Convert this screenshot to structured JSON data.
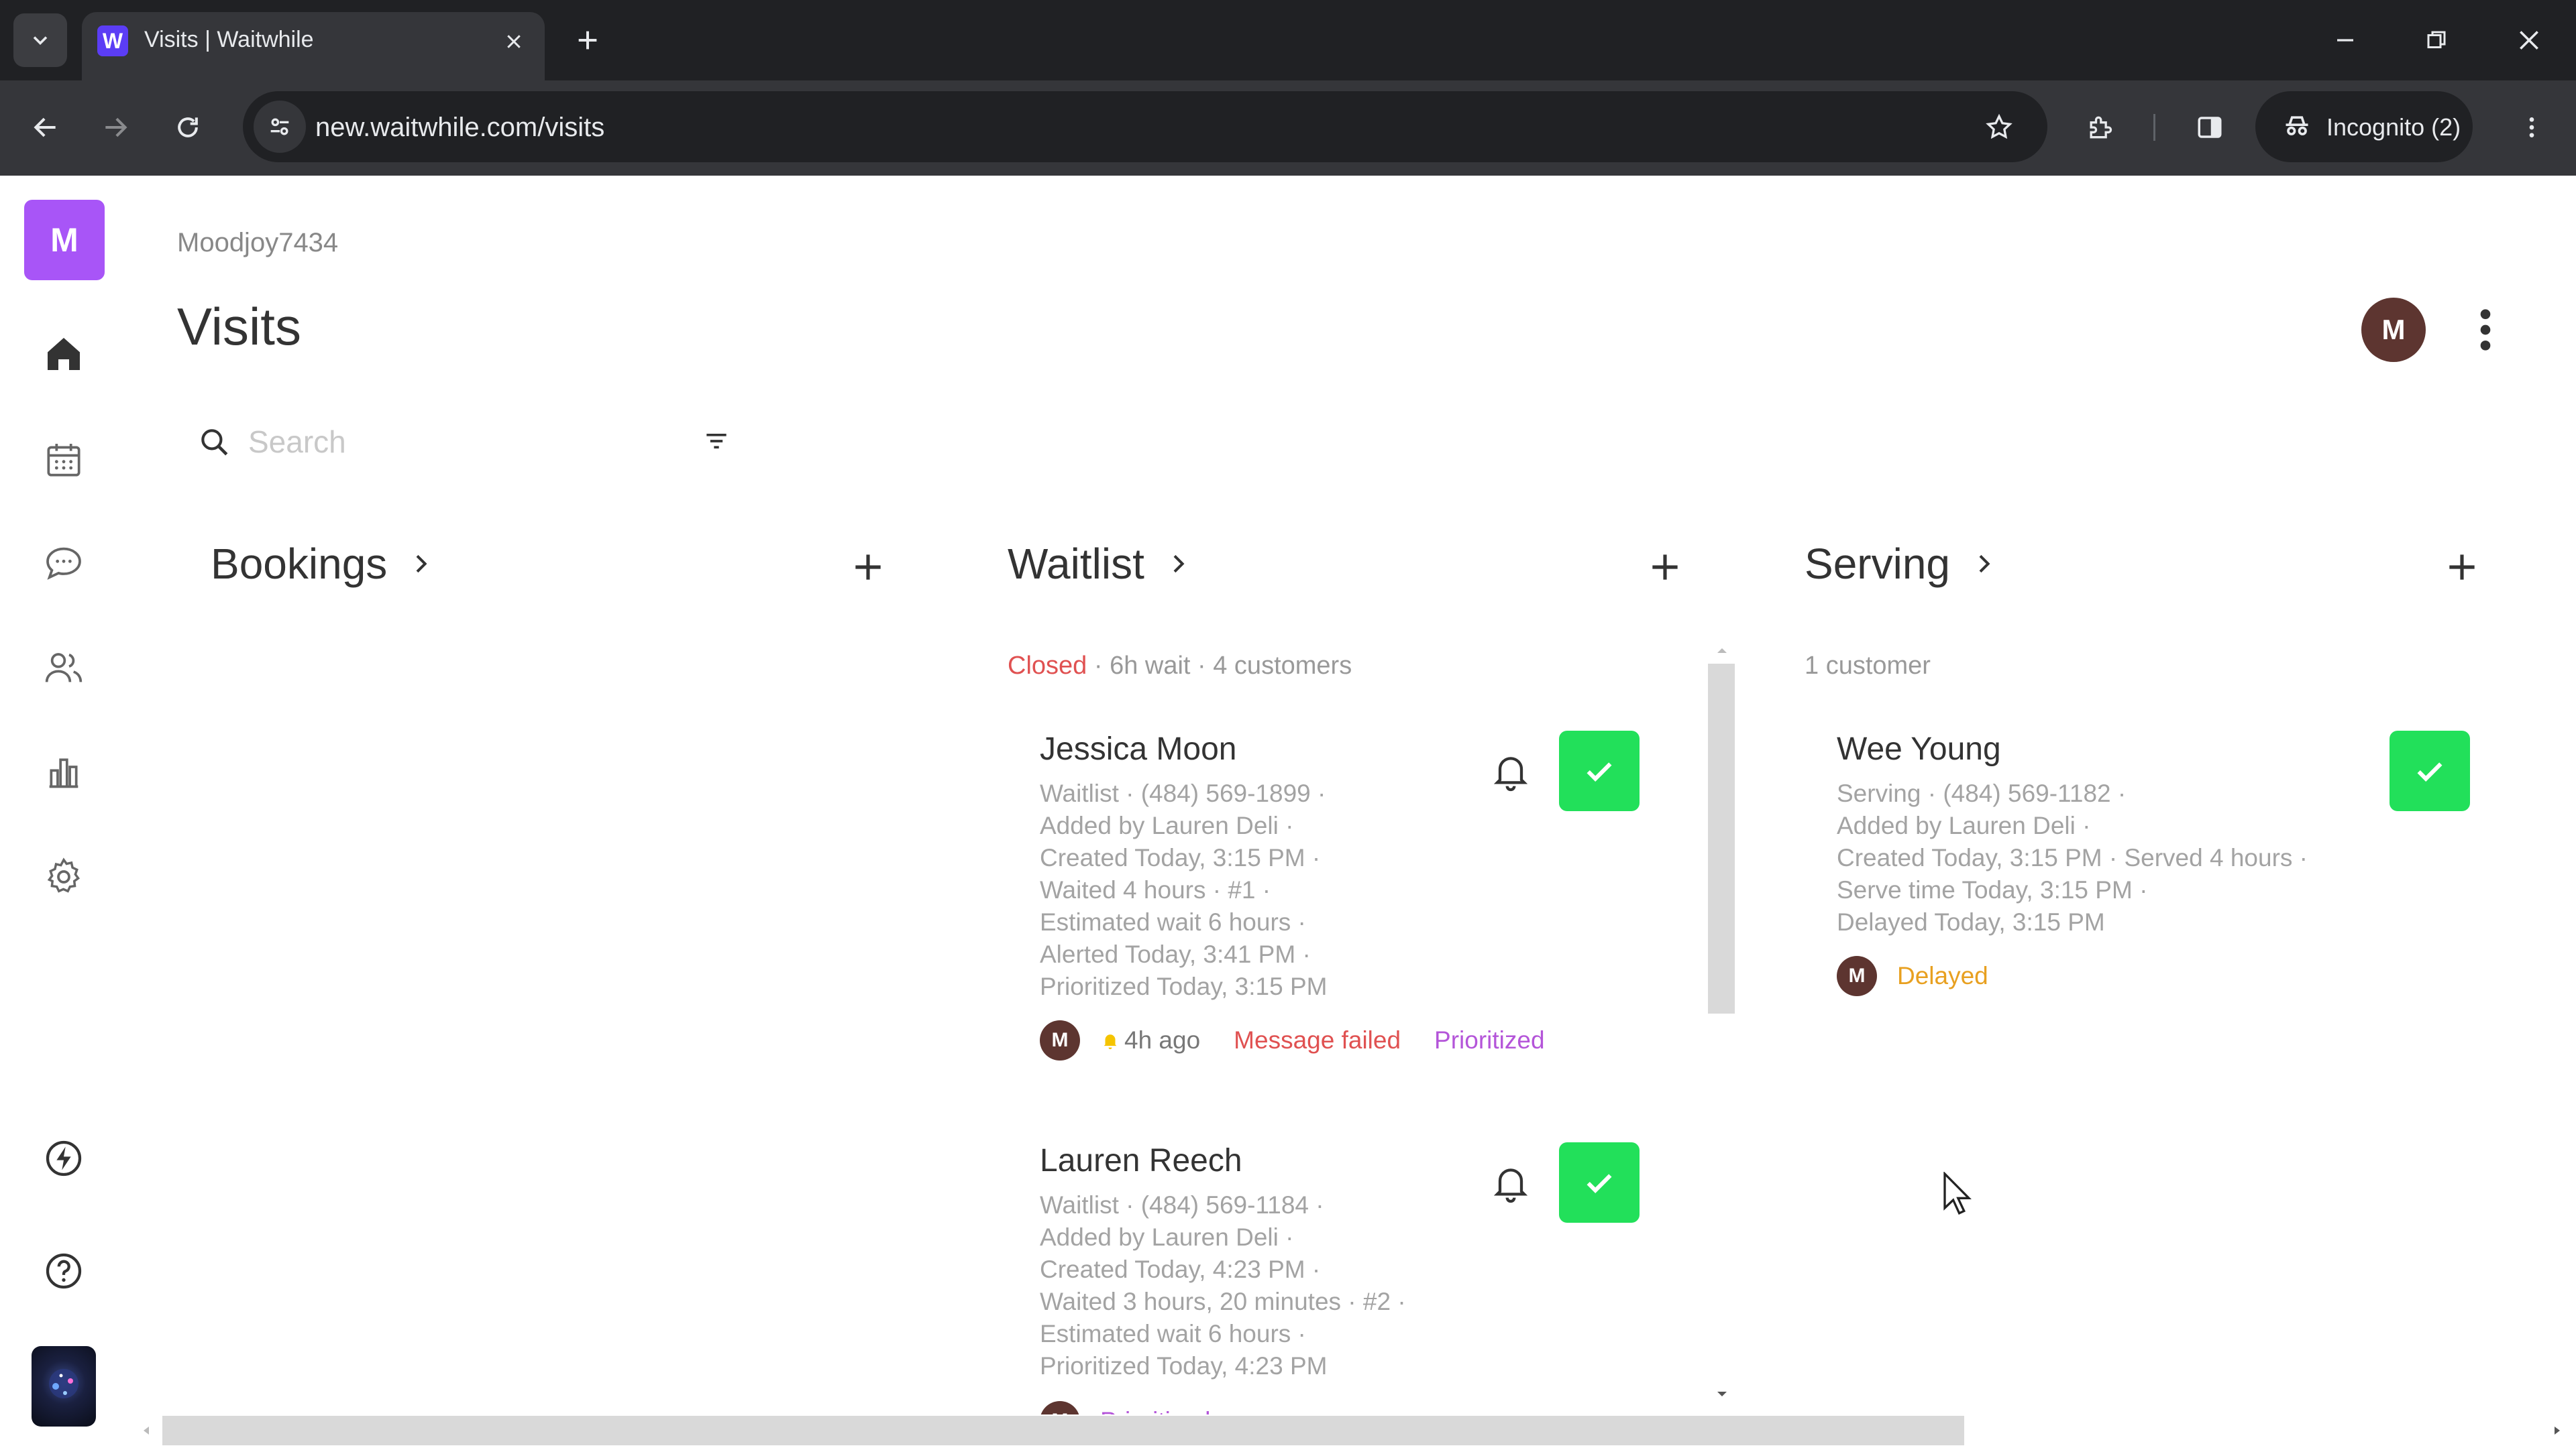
{
  "browser": {
    "tab_title": "Visits | Waitwhile",
    "favicon_letter": "W",
    "url": "new.waitwhile.com/visits",
    "incognito_label": "Incognito (2)"
  },
  "sidebar": {
    "workspace_initial": "M",
    "items": [
      {
        "name": "home"
      },
      {
        "name": "calendar"
      },
      {
        "name": "messages"
      },
      {
        "name": "customers"
      },
      {
        "name": "analytics"
      },
      {
        "name": "settings"
      },
      {
        "name": "integrations"
      },
      {
        "name": "help"
      }
    ]
  },
  "header": {
    "workspace_name": "Moodjoy7434",
    "page_title": "Visits",
    "user_initial": "M"
  },
  "search": {
    "placeholder": "Search"
  },
  "columns": {
    "bookings": {
      "title": "Bookings"
    },
    "waitlist": {
      "title": "Waitlist",
      "status": "Closed",
      "meta": "· 6h wait · 4 customers",
      "cards": [
        {
          "name": "Jessica Moon",
          "lines": [
            "Waitlist · (484) 569-1899 ·",
            "Added by Lauren Deli ·",
            "Created Today, 3:15 PM ·",
            "Waited 4 hours · #1 ·",
            "Estimated wait 6 hours ·",
            "Alerted Today, 3:41 PM ·",
            "Prioritized Today, 3:15 PM"
          ],
          "avatar_initial": "M",
          "alert_time": "4h ago",
          "tag_failed": "Message failed",
          "tag_prioritized": "Prioritized"
        },
        {
          "name": "Lauren Reech",
          "lines": [
            "Waitlist · (484) 569-1184 ·",
            "Added by Lauren Deli ·",
            "Created Today, 4:23 PM ·",
            "Waited 3 hours, 20 minutes · #2 ·",
            "Estimated wait 6 hours ·",
            "Prioritized Today, 4:23 PM"
          ],
          "avatar_initial": "M",
          "tag_prioritized": "Prioritized"
        }
      ]
    },
    "serving": {
      "title": "Serving",
      "meta": "1 customer",
      "cards": [
        {
          "name": "Wee Young",
          "lines": [
            "Serving · (484) 569-1182 ·",
            "Added by Lauren Deli ·",
            "Created Today, 3:15 PM · Served 4 hours ·",
            "Serve time Today, 3:15 PM ·",
            "Delayed Today, 3:15 PM"
          ],
          "avatar_initial": "M",
          "tag_delayed": "Delayed"
        }
      ]
    }
  },
  "colors": {
    "accent_green": "#22e05a",
    "closed_red": "#e05151",
    "failed_red": "#e05151",
    "prioritized_purple": "#b455d9",
    "delayed_orange": "#e8a020",
    "workspace_purple": "#a855f7"
  }
}
